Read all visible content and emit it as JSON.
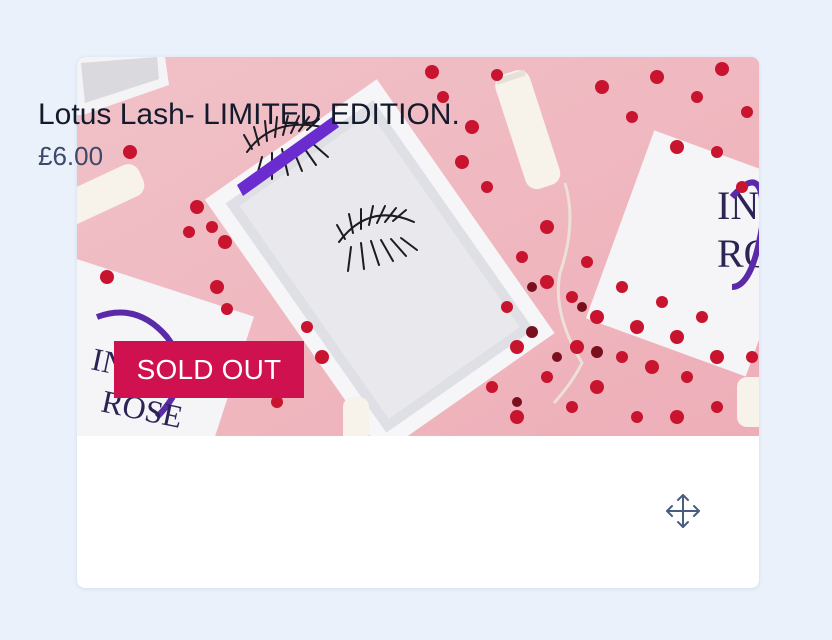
{
  "product": {
    "badge": "SOLD OUT",
    "name": "Lotus Lash- LIMITED EDITION.",
    "price": "£6.00",
    "image_alt": "Lotus Lash eyelashes in a white box on pink background with red heart confetti"
  },
  "photo": {
    "box_logo_top": "IN",
    "box_logo_bottom": "RO",
    "box_logo_left_line1": "IN GO",
    "box_logo_left_line2": "ROSE"
  },
  "controls": {
    "move_icon": "move-arrows-icon"
  },
  "colors": {
    "page_background": "#eaf1fb",
    "badge_background": "#cf1150",
    "title_text": "#131a2b",
    "price_text": "#3b4a6b",
    "photo_background": "#f0b7c0",
    "confetti": "#c8142e",
    "box_logo": "#5a2aa8"
  }
}
